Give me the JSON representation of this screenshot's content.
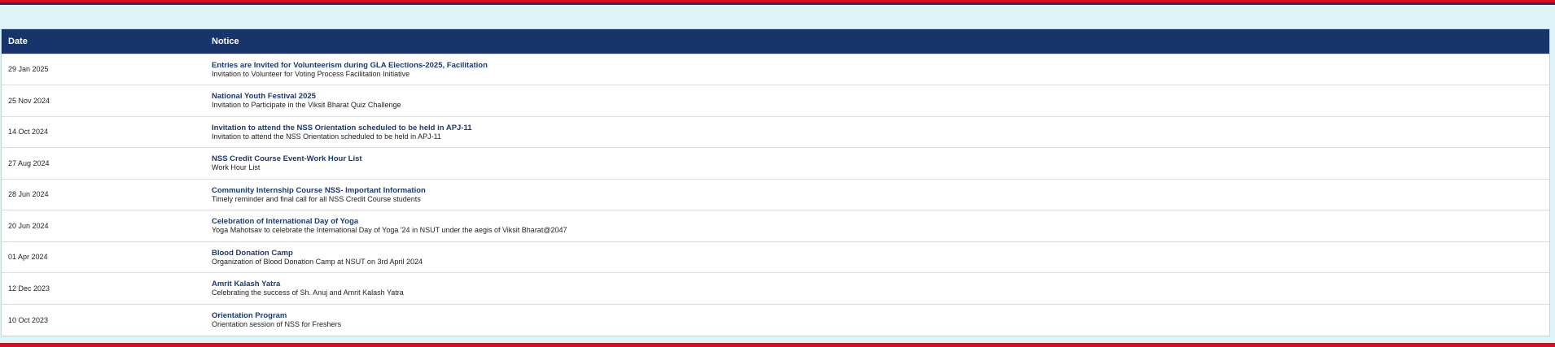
{
  "colors": {
    "header_bg": "#17356b",
    "accent_red": "#d0101e",
    "page_bg": "#dff4f6",
    "title_text": "#1b3a6e"
  },
  "table": {
    "headers": {
      "date": "Date",
      "notice": "Notice"
    },
    "rows": [
      {
        "date": "29 Jan 2025",
        "title": "Entries are Invited for Volunteerism during GLA Elections-2025, Facilitation",
        "desc": "Invitation to Volunteer for Voting Process Facilitation Initiative"
      },
      {
        "date": "25 Nov 2024",
        "title": "National Youth Festival 2025",
        "desc": "Invitation to Participate in the Viksit Bharat Quiz Challenge"
      },
      {
        "date": "14 Oct 2024",
        "title": "Invitation to attend the NSS Orientation scheduled to be held in APJ-11",
        "desc": "Invitation to attend the NSS Orientation scheduled to be held in APJ-11"
      },
      {
        "date": "27 Aug 2024",
        "title": "NSS Credit Course Event-Work Hour List",
        "desc": "Work Hour List"
      },
      {
        "date": "28 Jun 2024",
        "title": "Community Internship Course NSS- Important Information",
        "desc": "Timely reminder and final call for all NSS Credit Course students"
      },
      {
        "date": "20 Jun 2024",
        "title": "Celebration of International Day of Yoga",
        "desc": "Yoga Mahotsav to celebrate the International Day of Yoga '24 in NSUT under the aegis of Viksit Bharat@2047"
      },
      {
        "date": "01 Apr 2024",
        "title": "Blood Donation Camp",
        "desc": "Organization of Blood Donation Camp at NSUT on 3rd April 2024"
      },
      {
        "date": "12 Dec 2023",
        "title": "Amrit Kalash Yatra",
        "desc": "Celebrating the success of Sh. Anuj and Amrit Kalash Yatra"
      },
      {
        "date": "10 Oct 2023",
        "title": "Orientation Program",
        "desc": "Orientation session of NSS for Freshers"
      }
    ]
  }
}
